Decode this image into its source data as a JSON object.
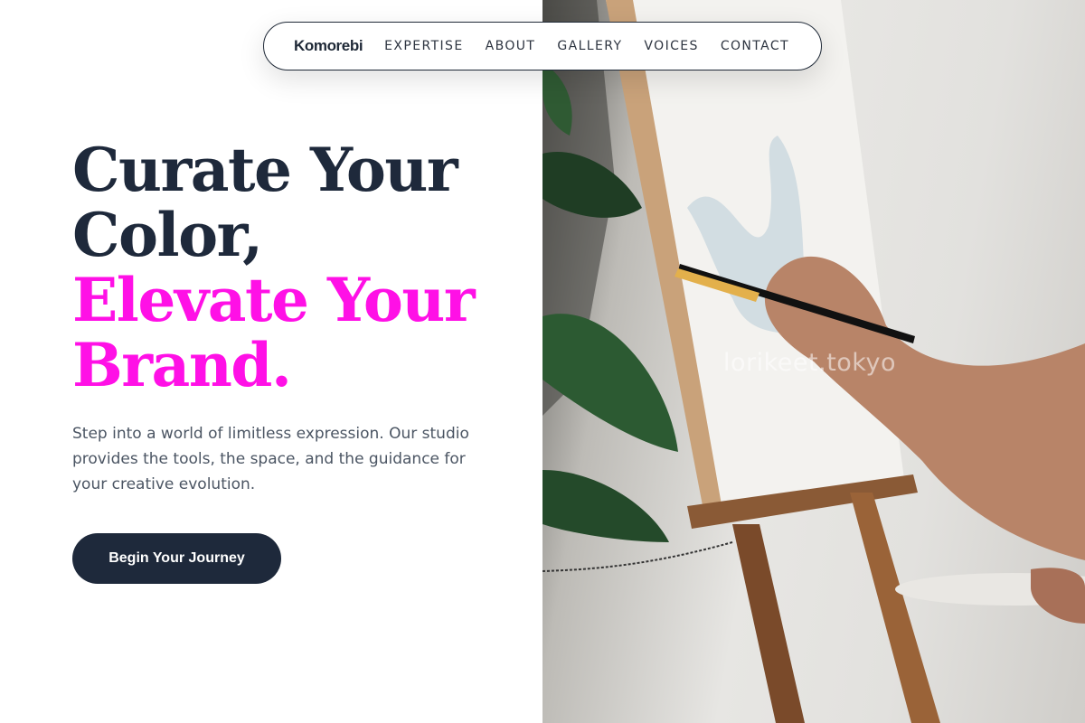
{
  "nav": {
    "brand": "Komorebi",
    "links": [
      "EXPERTISE",
      "ABOUT",
      "GALLERY",
      "VOICES",
      "CONTACT"
    ]
  },
  "hero": {
    "headline_line1": "Curate Your",
    "headline_line2": "Color,",
    "headline_line3": "Elevate Your",
    "headline_line4": "Brand.",
    "subtext": "Step into a world of limitless expression. Our studio provides the tools, the space, and the guidance for your creative evolution.",
    "cta_label": "Begin Your Journey"
  },
  "photo": {
    "watermark": "lorikeet.tokyo",
    "icon": "painter-at-easel-photo"
  },
  "colors": {
    "dark": "#1e293b",
    "accent": "#ff10e6",
    "body_text": "#4b5563"
  }
}
